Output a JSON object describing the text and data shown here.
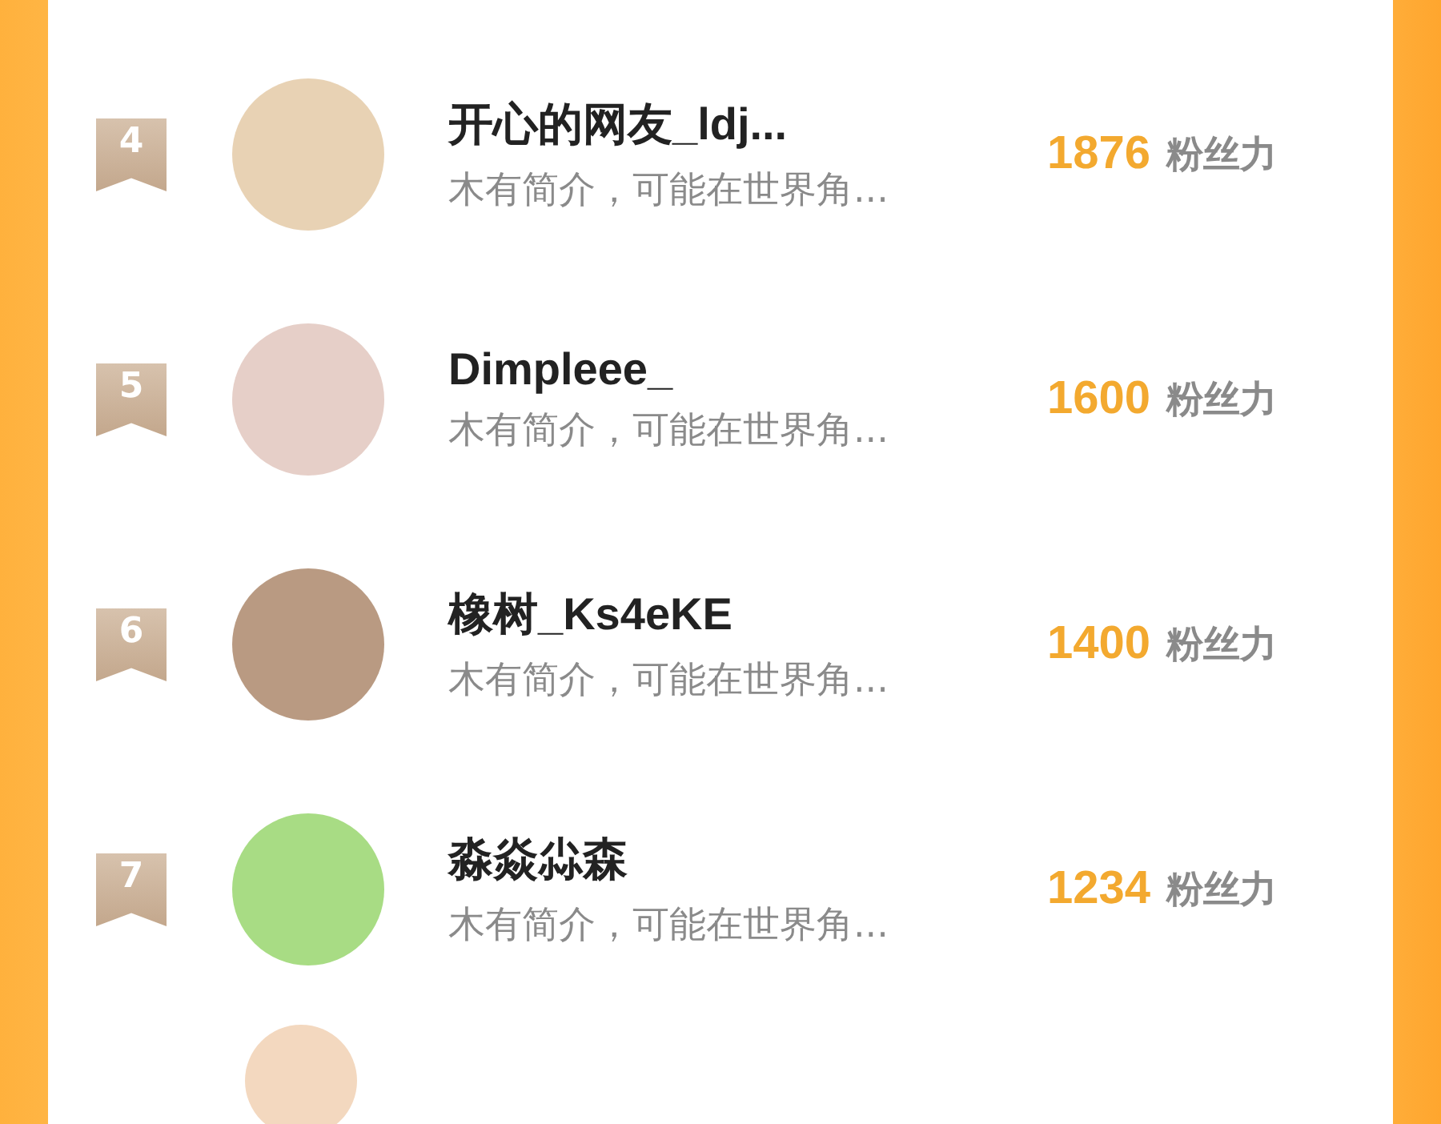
{
  "ranking": [
    {
      "rank": "4",
      "name": "开心的网友_ldj...",
      "bio": "木有简介，可能在世界角...",
      "score": "1876",
      "unit": "粉丝力"
    },
    {
      "rank": "5",
      "name": "Dimpleee_",
      "bio": "木有简介，可能在世界角...",
      "score": "1600",
      "unit": "粉丝力"
    },
    {
      "rank": "6",
      "name": "橡树_Ks4eKE",
      "bio": "木有简介，可能在世界角...",
      "score": "1400",
      "unit": "粉丝力"
    },
    {
      "rank": "7",
      "name": "淼焱尛森",
      "bio": "木有简介，可能在世界角...",
      "score": "1234",
      "unit": "粉丝力"
    }
  ]
}
